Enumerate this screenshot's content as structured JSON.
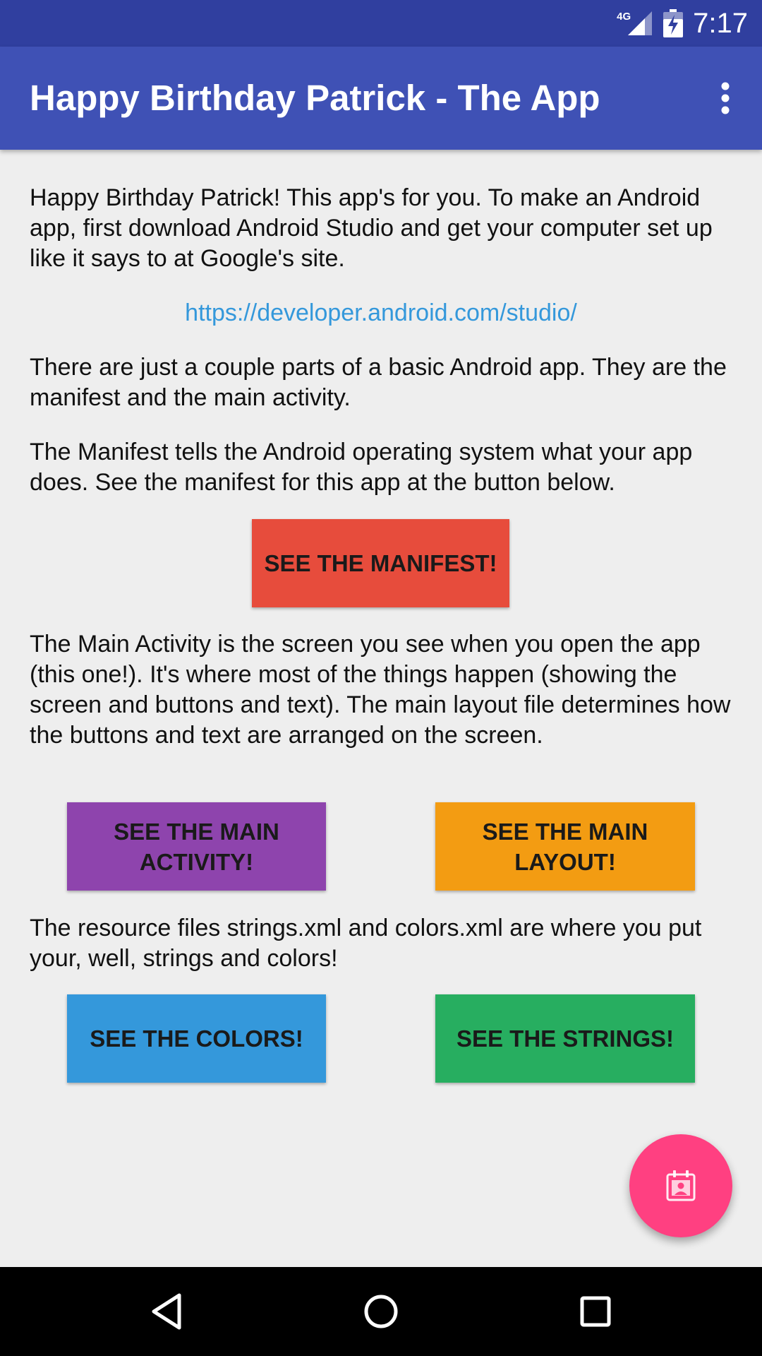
{
  "status_bar": {
    "network_label": "4G",
    "time": "7:17",
    "icons": [
      "signal-icon",
      "battery-charging-icon"
    ]
  },
  "app_bar": {
    "title": "Happy Birthday Patrick - The App",
    "menu_icon": "overflow-menu-icon"
  },
  "content": {
    "intro": "Happy Birthday Patrick! This app's for you. To make an Android app, first download Android Studio and get your computer set up like it says to at Google's site.",
    "link": "https://developer.android.com/studio/",
    "parts": "There are just a couple parts of a basic Android app. They are the manifest and the main activity.",
    "manifest_text": "The Manifest tells the Android operating system what your app does. See the manifest for this app at the button below.",
    "manifest_button": "SEE THE MANIFEST!",
    "main_activity_text": "The Main Activity is the screen you see when you open the app (this one!). It's where most of the things happen (showing the screen and buttons and text). The main layout file determines how the buttons and text are arranged on the screen.",
    "main_activity_button": "SEE THE MAIN ACTIVITY!",
    "main_layout_button": "SEE THE MAIN LAYOUT!",
    "resources_text": "The resource files strings.xml and colors.xml are where you put your, well, strings and colors!",
    "colors_button": "SEE THE COLORS!",
    "strings_button": "SEE THE STRINGS!"
  },
  "fab": {
    "icon": "calendar-person-icon"
  },
  "nav_bar": {
    "icons": [
      "back-icon",
      "home-icon",
      "recents-icon"
    ]
  },
  "colors": {
    "status_bar": "#303f9f",
    "app_bar": "#3f51b5",
    "background": "#eeeeee",
    "link": "#3498db",
    "manifest_button": "#e74c3c",
    "main_activity_button": "#8e44ad",
    "main_layout_button": "#f39c12",
    "colors_button": "#3498db",
    "strings_button": "#27ae60",
    "fab": "#ff4081"
  }
}
